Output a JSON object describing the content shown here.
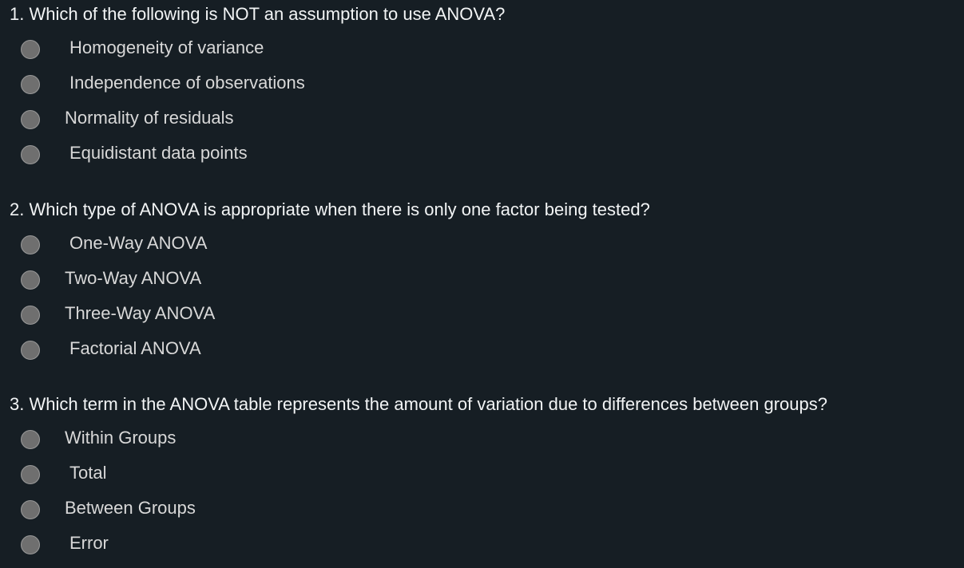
{
  "questions": [
    {
      "text": "1.  Which of the following is NOT an assumption to use ANOVA?",
      "options": [
        {
          "label": "Homogeneity of variance"
        },
        {
          "label": "Independence of observations"
        },
        {
          "label": "Normality of residuals"
        },
        {
          "label": "Equidistant data points"
        }
      ]
    },
    {
      "text": "2.  Which type of ANOVA is appropriate when there is only one factor being tested?",
      "options": [
        {
          "label": "One-Way ANOVA"
        },
        {
          "label": "Two-Way ANOVA"
        },
        {
          "label": "Three-Way ANOVA"
        },
        {
          "label": "Factorial ANOVA"
        }
      ]
    },
    {
      "text": "3.  Which term in the ANOVA table represents the amount of variation due to differences between groups?",
      "options": [
        {
          "label": "Within Groups"
        },
        {
          "label": "Total"
        },
        {
          "label": "Between Groups"
        },
        {
          "label": "Error"
        }
      ]
    }
  ],
  "colors": {
    "background": "#161e24",
    "question_text": "#f2f4f5",
    "option_text": "#d8d8d8",
    "radio_fill": "#6f6f6f",
    "radio_border": "#9a9a9a"
  }
}
